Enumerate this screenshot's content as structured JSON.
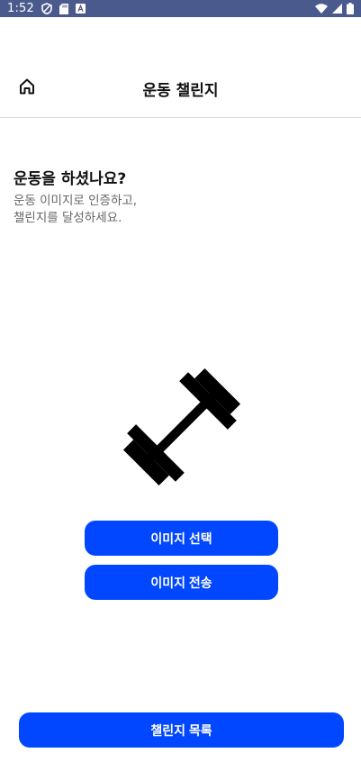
{
  "status_bar": {
    "time": "1:52",
    "left_icons": [
      "shield-icon",
      "sd-card-icon",
      "keyboard-a-icon"
    ],
    "right_icons": [
      "wifi-icon",
      "signal-icon",
      "battery-icon"
    ],
    "background": "#4a5a8c"
  },
  "app_bar": {
    "title": "운동 챌린지",
    "home_icon": "home-icon"
  },
  "main": {
    "headline": "운동을 하셨나요?",
    "subtext_line1": "운동 이미지로 인증하고,",
    "subtext_line2": "챌린지를 달성하세요.",
    "illustration_icon": "dumbbell-icon"
  },
  "buttons": {
    "select_image": "이미지 선택",
    "send_image": "이미지 전송",
    "challenge_list": "챌린지 목록"
  },
  "colors": {
    "accent": "#0047ff",
    "text_primary": "#111111",
    "text_secondary": "#666666",
    "divider": "#d7d7d7"
  }
}
